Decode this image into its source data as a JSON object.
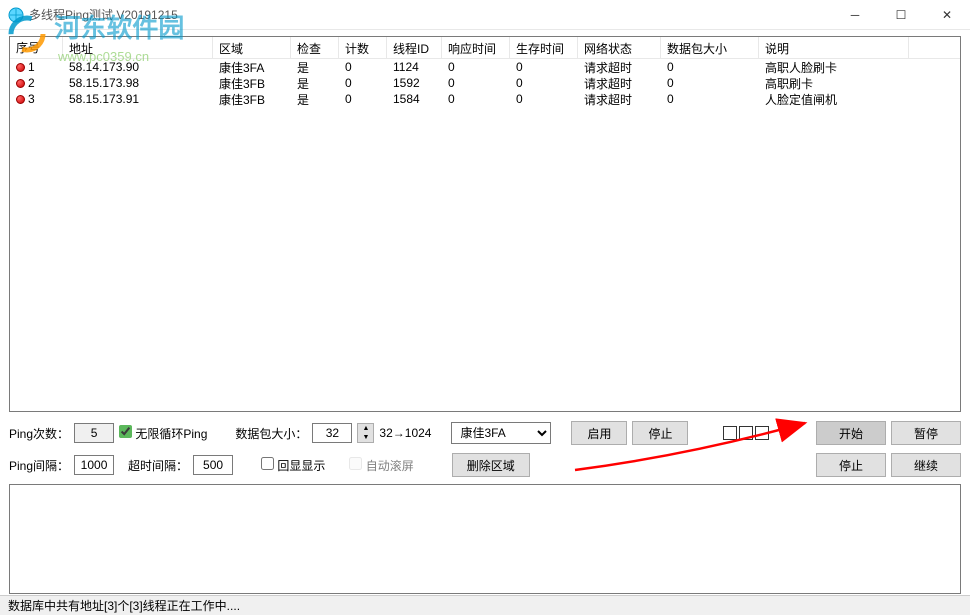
{
  "window": {
    "title": "多线程Ping测试 V20191215"
  },
  "watermark": {
    "text": "河东软件园",
    "url": "www.pc0359.cn"
  },
  "columns": {
    "idx": "序号",
    "addr": "地址",
    "area": "区域",
    "check": "检查",
    "count": "计数",
    "tid": "线程ID",
    "resp": "响应时间",
    "ttl": "生存时间",
    "net": "网络状态",
    "pkt": "数据包大小",
    "desc": "说明"
  },
  "rows": [
    {
      "idx": "1",
      "addr": "58.14.173.90",
      "area": "康佳3FA",
      "check": "是",
      "count": "0",
      "tid": "1124",
      "resp": "0",
      "ttl": "0",
      "net": "请求超时",
      "pkt": "0",
      "desc": "高职人脸刷卡"
    },
    {
      "idx": "2",
      "addr": "58.15.173.98",
      "area": "康佳3FB",
      "check": "是",
      "count": "0",
      "tid": "1592",
      "resp": "0",
      "ttl": "0",
      "net": "请求超时",
      "pkt": "0",
      "desc": "高职刷卡"
    },
    {
      "idx": "3",
      "addr": "58.15.173.91",
      "area": "康佳3FB",
      "check": "是",
      "count": "0",
      "tid": "1584",
      "resp": "0",
      "ttl": "0",
      "net": "请求超时",
      "pkt": "0",
      "desc": "人脸定值闸机"
    }
  ],
  "controls": {
    "pingCountLabel": "Ping次数：",
    "pingCountValue": "5",
    "infiniteLoop": "无限循环Ping",
    "pktSizeLabel": "数据包大小：",
    "pktSizeValue": "32",
    "pktRange": "32→1024",
    "areaSelect": "康佳3FA",
    "enable": "启用",
    "stop1": "停止",
    "start": "开始",
    "pause": "暂停",
    "pingIntervalLabel": "Ping间隔：",
    "pingIntervalValue": "1000",
    "timeoutLabel": "超时间隔：",
    "timeoutValue": "500",
    "echo": "回显显示",
    "autoscroll": "自动滚屏",
    "deleteArea": "删除区域",
    "stop2": "停止",
    "continue": "继续"
  },
  "status": {
    "left": "数据库中共有地址[3]个",
    "mid": "[3]线程正在工作中...."
  }
}
